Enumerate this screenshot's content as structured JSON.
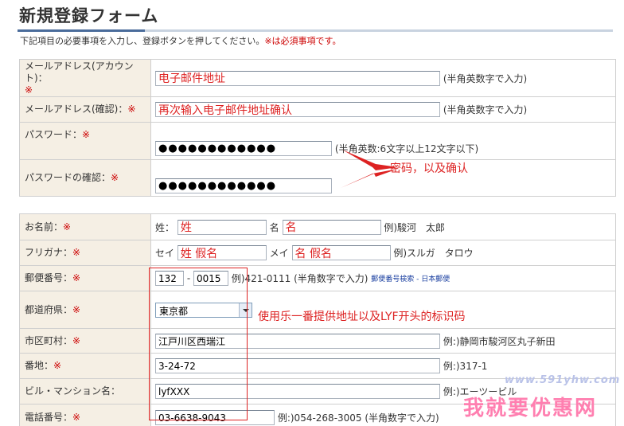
{
  "page": {
    "title": "新規登録フォーム",
    "intro_text": "下記項目の必要事項を入力し、登録ボタンを押してください。",
    "intro_required": "※は必須事項です。"
  },
  "required_mark": "※",
  "account": {
    "email_label": "メールアドレス(アカウント)：",
    "email_value": "电子邮件地址",
    "email_hint": "(半角英数字で入力)",
    "email_confirm_label": "メールアドレス(確認)：",
    "email_confirm_value": "再次输入电子邮件地址确认",
    "email_confirm_hint": "(半角英数字で入力)",
    "password_label": "パスワード：",
    "password_value": "●●●●●●●●●●●●",
    "password_hint": "(半角英数:6文字以上12文字以下)",
    "password_confirm_label": "パスワードの確認：",
    "password_confirm_value": "●●●●●●●●●●●●"
  },
  "profile": {
    "name_label": "お名前：",
    "sei_label": "姓：",
    "sei_value": "姓",
    "mei_label": "名",
    "mei_value": "名",
    "name_example": "例)駿河　太郎",
    "kana_label": "フリガナ：",
    "sei_kana_label": "セイ",
    "sei_kana_value": "姓 假名",
    "mei_kana_label": "メイ",
    "mei_kana_value": "名 假名",
    "kana_example": "例)スルガ　タロウ",
    "zip_label": "郵便番号：",
    "zip1_value": "132",
    "zip_sep": "-",
    "zip2_value": "0015",
    "zip_example": "例)421-0111 (半角数字で入力)",
    "zip_link": "郵便番号検索 - 日本郵便",
    "pref_label": "都道府県：",
    "pref_value": "東京都",
    "city_label": "市区町村：",
    "city_value": "江戸川区西瑞江",
    "city_example": "例:)静岡市駿河区丸子新田",
    "street_label": "番地：",
    "street_value": "3-24-72",
    "street_example": "例:)317-1",
    "building_label": "ビル・マンション名：",
    "building_value": "lyfXXX",
    "building_example": "例:)エーツービル",
    "phone_label": "電話番号：",
    "phone_value": "03-6638-9043",
    "phone_example": "例:)054-268-3005 (半角数字で入力)"
  },
  "annotations": {
    "password_note": "密码，以及确认",
    "address_note": "使用乐一番提供地址以及LYF开头的标识码",
    "color": "#dd2222"
  },
  "watermark": {
    "url": "www.591yhw.com",
    "text": "我就要优惠网"
  },
  "colors": {
    "label_bg": "#f5efe4",
    "border": "#cfcfcf",
    "title_rule": "#4a6c9b",
    "required": "#cc0000"
  }
}
